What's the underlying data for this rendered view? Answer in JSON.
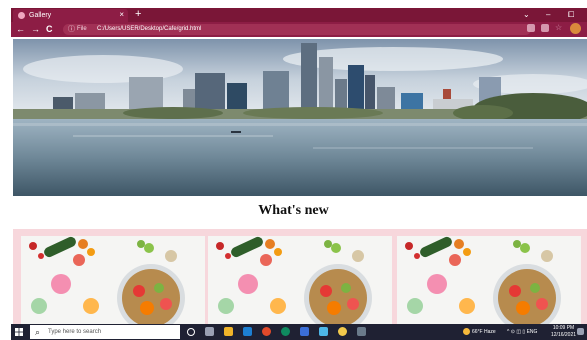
{
  "browser": {
    "tab_title": "Gallery",
    "tab_close": "×",
    "new_tab": "+",
    "window_controls": [
      "⌄",
      "–",
      "⧠"
    ],
    "nav": {
      "back": "←",
      "forward": "→",
      "reload": "C"
    },
    "info_icon": "ⓘ",
    "url_label": "File",
    "url": "C:/Users/USER/Desktop/Cafe/grid.html"
  },
  "page": {
    "heading": "What's new",
    "hero_image": "city-skyline-river-image",
    "cards": [
      "food-bowl-image",
      "food-bowl-image",
      "food-bowl-image"
    ]
  },
  "taskbar": {
    "search_icon": "⌕",
    "search_placeholder": "Type here to search",
    "weather": "66°F Haze",
    "tray_icons": "^ ⊙ ◫ ▯ ENG",
    "time": "10:09 PM",
    "date": "12/16/2021"
  },
  "colors": {
    "browser_chrome": "#7a1637",
    "address_bar": "#8d1d45",
    "card_background": "#f7d7dc",
    "taskbar": "#1f2133"
  }
}
